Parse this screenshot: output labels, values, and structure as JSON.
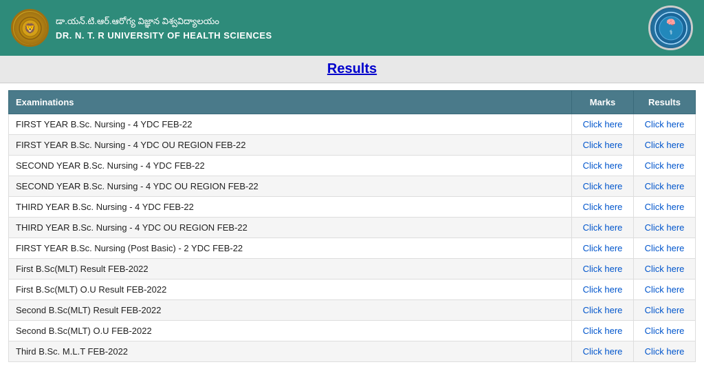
{
  "header": {
    "telugu_name": "డా.యన్.టి.ఆర్.ఆరోగ్య విజ్ఞాన విశ్వవిద్యాలయం",
    "english_name": "DR. N. T. R UNIVERSITY OF HEALTH SCIENCES",
    "logo_icon": "🏛️",
    "emblem_icon": "🎓"
  },
  "page": {
    "title": "Results"
  },
  "table": {
    "headers": {
      "exam": "Examinations",
      "marks": "Marks",
      "results": "Results"
    },
    "rows": [
      {
        "exam": "FIRST YEAR B.Sc. Nursing - 4 YDC FEB-22",
        "marks_link": "Click here",
        "results_link": "Click here"
      },
      {
        "exam": "FIRST YEAR B.Sc. Nursing - 4 YDC OU REGION FEB-22",
        "marks_link": "Click here",
        "results_link": "Click here"
      },
      {
        "exam": "SECOND YEAR B.Sc. Nursing - 4 YDC FEB-22",
        "marks_link": "Click here",
        "results_link": "Click here"
      },
      {
        "exam": "SECOND YEAR B.Sc. Nursing - 4 YDC OU REGION FEB-22",
        "marks_link": "Click here",
        "results_link": "Click here"
      },
      {
        "exam": "THIRD YEAR B.Sc. Nursing - 4 YDC FEB-22",
        "marks_link": "Click here",
        "results_link": "Click here"
      },
      {
        "exam": "THIRD YEAR B.Sc. Nursing - 4 YDC OU REGION FEB-22",
        "marks_link": "Click here",
        "results_link": "Click here"
      },
      {
        "exam": "FIRST YEAR B.Sc. Nursing (Post Basic) - 2 YDC FEB-22",
        "marks_link": "Click here",
        "results_link": "Click here"
      },
      {
        "exam": "First B.Sc(MLT) Result FEB-2022",
        "marks_link": "Click here",
        "results_link": "Click here"
      },
      {
        "exam": "First B.Sc(MLT) O.U Result FEB-2022",
        "marks_link": "Click here",
        "results_link": "Click here"
      },
      {
        "exam": "Second B.Sc(MLT) Result FEB-2022",
        "marks_link": "Click here",
        "results_link": "Click here"
      },
      {
        "exam": "Second B.Sc(MLT) O.U FEB-2022",
        "marks_link": "Click here",
        "results_link": "Click here"
      },
      {
        "exam": "Third B.Sc. M.L.T FEB-2022",
        "marks_link": "Click here",
        "results_link": "Click here"
      }
    ]
  }
}
